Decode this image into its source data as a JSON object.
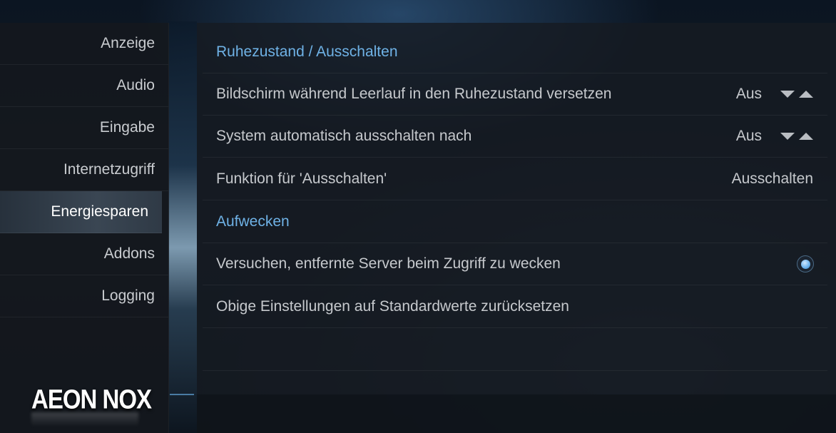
{
  "sidebar": {
    "items": [
      {
        "label": "Anzeige"
      },
      {
        "label": "Audio"
      },
      {
        "label": "Eingabe"
      },
      {
        "label": "Internetzugriff"
      },
      {
        "label": "Energiesparen"
      },
      {
        "label": "Addons"
      },
      {
        "label": "Logging"
      }
    ],
    "active_index": 4
  },
  "logo": {
    "text": "AEON NOX"
  },
  "main": {
    "rows": [
      {
        "type": "header",
        "label": "Ruhezustand / Ausschalten"
      },
      {
        "type": "spinner",
        "label": "Bildschirm während Leerlauf in den Ruhezustand versetzen",
        "value": "Aus",
        "icons": [
          "arrow-down-icon",
          "arrow-up-icon"
        ]
      },
      {
        "type": "spinner",
        "label": "System automatisch ausschalten nach",
        "value": "Aus",
        "icons": [
          "arrow-down-icon",
          "arrow-up-icon"
        ]
      },
      {
        "type": "value",
        "label": "Funktion für 'Ausschalten'",
        "value": "Ausschalten"
      },
      {
        "type": "header",
        "label": "Aufwecken"
      },
      {
        "type": "toggle",
        "label": "Versuchen, entfernte Server beim Zugriff zu wecken",
        "checked": true,
        "icon": "radio-on-icon"
      },
      {
        "type": "action",
        "label": "Obige Einstellungen auf Standardwerte zurücksetzen"
      }
    ]
  },
  "colors": {
    "accent": "#6fb2e6",
    "text": "#c6c9cd",
    "active_text": "#ffffff"
  }
}
